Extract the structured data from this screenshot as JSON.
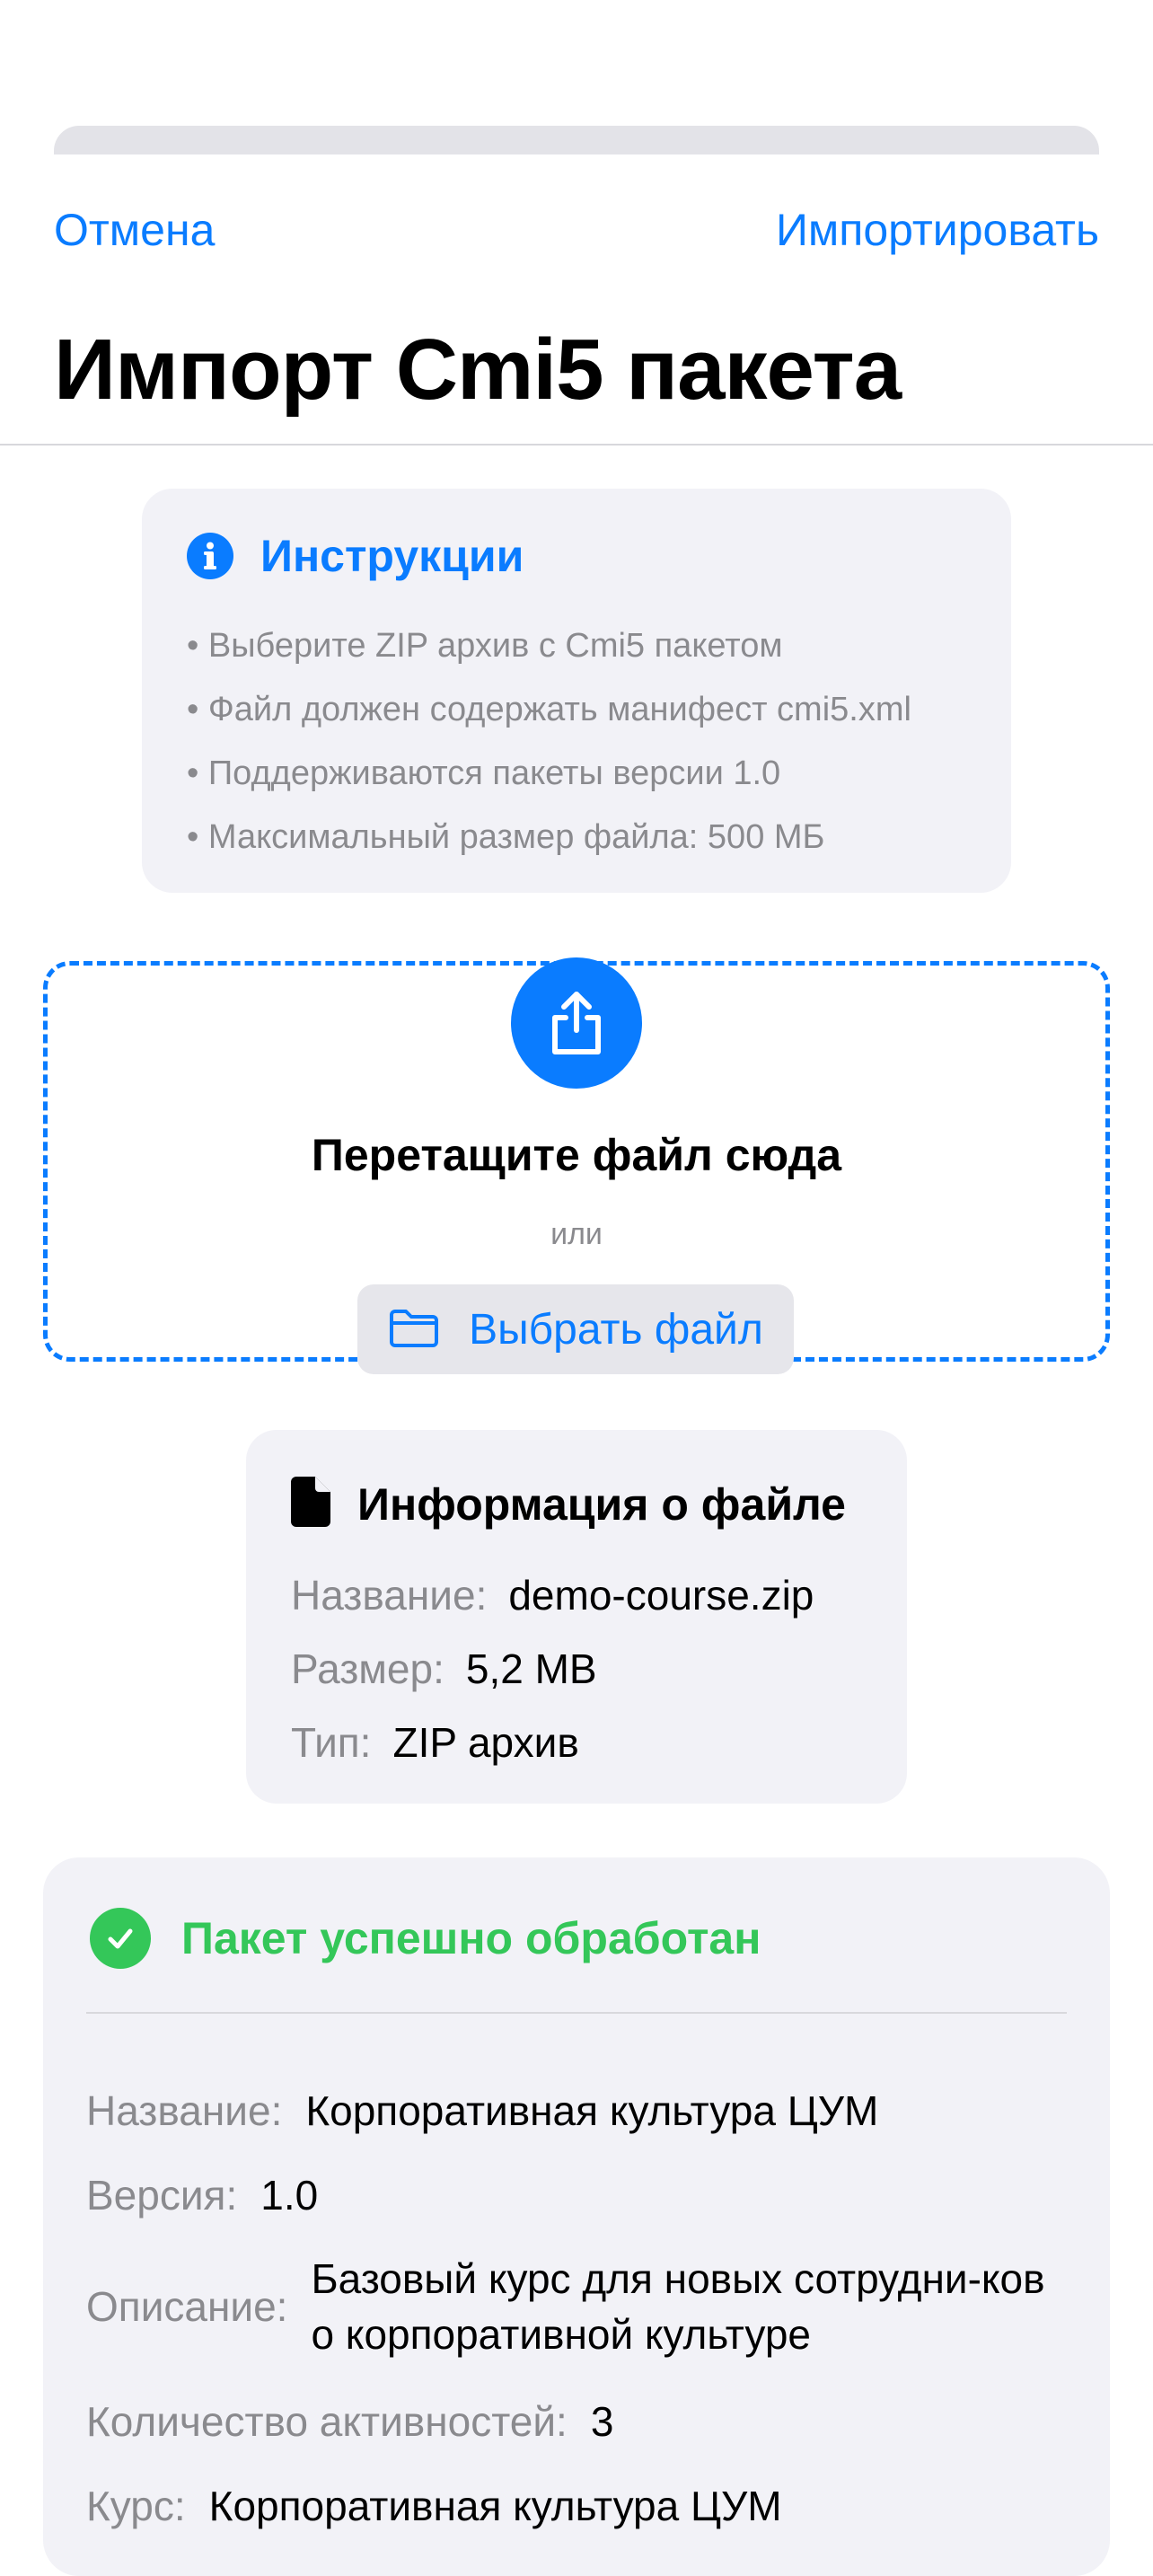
{
  "nav": {
    "cancel_label": "Отмена",
    "import_label": "Импортировать"
  },
  "page_title": "Импорт Cmi5 пакета",
  "instructions": {
    "icon": "info-icon",
    "title": "Инструкции",
    "items": [
      "• Выберите ZIP архив с Cmi5 пакетом",
      "• Файл должен содержать манифест cmi5.xml",
      "• Поддерживаются пакеты версии 1.0",
      "• Максимальный размер файла: 500 МБ"
    ]
  },
  "dropzone": {
    "icon": "upload-icon",
    "title": "Перетащите файл сюда",
    "or_text": "или",
    "choose_icon": "folder-icon",
    "choose_label": "Выбрать файл"
  },
  "file_info": {
    "icon": "document-icon",
    "title": "Информация о файле",
    "rows": [
      {
        "label": "Название:",
        "value": "demo-course.zip"
      },
      {
        "label": "Размер:",
        "value": "5,2 MB"
      },
      {
        "label": "Тип:",
        "value": "ZIP архив"
      }
    ]
  },
  "result": {
    "icon": "checkmark-circle-icon",
    "title": "Пакет успешно обработан",
    "rows": [
      {
        "label": "Название:",
        "value": "Корпоративная культура ЦУМ"
      },
      {
        "label": "Версия:",
        "value": "1.0"
      },
      {
        "label": "Описание:",
        "value": "Базовый курс для новых сотрудни-ков о корпоративной культуре"
      },
      {
        "label": "Количество активностей:",
        "value": "3"
      },
      {
        "label": "Курс:",
        "value": "Корпоративная культура ЦУМ"
      }
    ]
  },
  "colors": {
    "accent": "#0a7cff",
    "success": "#34c759",
    "card_bg": "#f2f2f7",
    "secondary_text": "#8a8a8e"
  }
}
